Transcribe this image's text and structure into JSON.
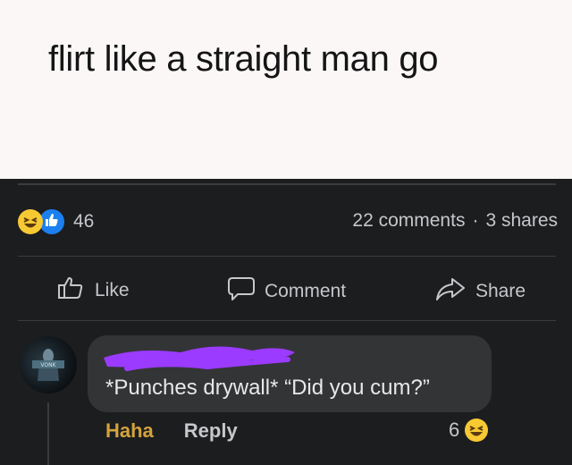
{
  "post": {
    "text": "flirt like a straight man go"
  },
  "reactions": {
    "count": "46",
    "icons": [
      "haha-icon",
      "like-icon"
    ],
    "comments": "22 comments",
    "separator": "·",
    "shares": "3 shares"
  },
  "actions": {
    "like": "Like",
    "comment": "Comment",
    "share": "Share"
  },
  "comment": {
    "text": "*Punches drywall*  “Did you cum?”",
    "haha_label": "Haha",
    "reply_label": "Reply",
    "reaction_count": "6",
    "avatar_badge": "VONK"
  },
  "colors": {
    "background": "#1c1d1f",
    "bubble": "#333436",
    "haha_yellow": "#f7c933",
    "like_blue": "#1b7ff0",
    "active_reaction": "#d3a33e",
    "redaction_purple": "#9b3bff"
  }
}
